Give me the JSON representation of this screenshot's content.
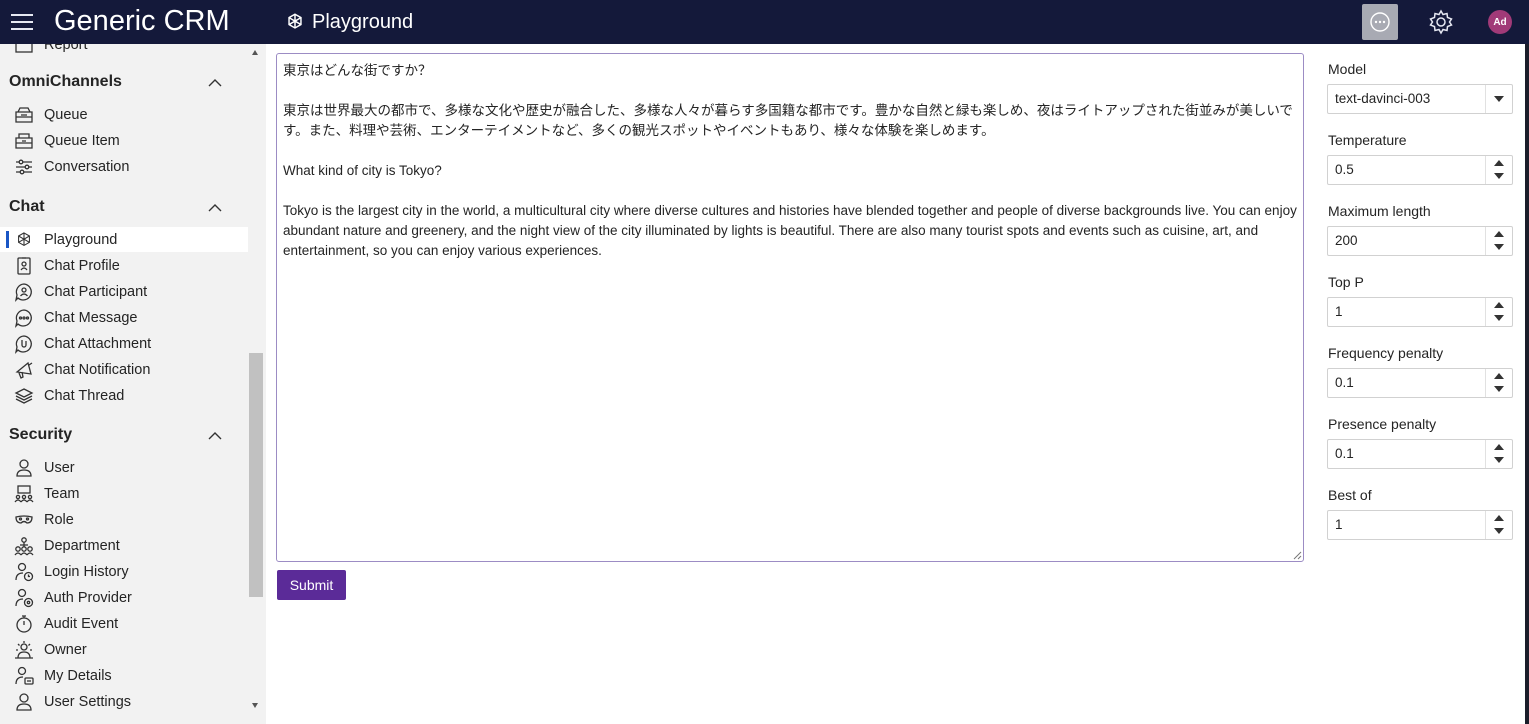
{
  "app": {
    "title": "Generic CRM",
    "page_title": "Playground",
    "avatar_initials": "Ad"
  },
  "sidebar": {
    "partial_item": "Report",
    "sections": [
      {
        "label": "OmniChannels",
        "items": [
          {
            "label": "Queue",
            "icon": "queue-icon"
          },
          {
            "label": "Queue Item",
            "icon": "queue-item-icon"
          },
          {
            "label": "Conversation",
            "icon": "sliders-icon"
          }
        ]
      },
      {
        "label": "Chat",
        "items": [
          {
            "label": "Playground",
            "icon": "openai-icon",
            "active": true
          },
          {
            "label": "Chat Profile",
            "icon": "id-badge-icon"
          },
          {
            "label": "Chat Participant",
            "icon": "person-bubble-icon"
          },
          {
            "label": "Chat Message",
            "icon": "chat-dots-icon"
          },
          {
            "label": "Chat Attachment",
            "icon": "chat-attachment-icon"
          },
          {
            "label": "Chat Notification",
            "icon": "megaphone-icon"
          },
          {
            "label": "Chat Thread",
            "icon": "layers-icon"
          }
        ]
      },
      {
        "label": "Security",
        "items": [
          {
            "label": "User",
            "icon": "person-icon"
          },
          {
            "label": "Team",
            "icon": "team-icon"
          },
          {
            "label": "Role",
            "icon": "mask-icon"
          },
          {
            "label": "Department",
            "icon": "org-chart-icon"
          },
          {
            "label": "Login History",
            "icon": "person-clock-icon"
          },
          {
            "label": "Auth Provider",
            "icon": "person-key-icon"
          },
          {
            "label": "Audit Event",
            "icon": "stopwatch-icon"
          },
          {
            "label": "Owner",
            "icon": "owner-icon"
          },
          {
            "label": "My Details",
            "icon": "person-card-icon"
          },
          {
            "label": "User Settings",
            "icon": "person-settings-icon"
          }
        ]
      }
    ]
  },
  "prompt": {
    "paragraphs": [
      "東京はどんな街ですか？",
      "東京は世界最大の都市で、多様な文化や歴史が融合した、多様な人々が暮らす多国籍な都市です。豊かな自然と緑も楽しめ、夜はライトアップされた街並みが美しいです。また、料理や芸術、エンターテイメントなど、多くの観光スポットやイベントもあり、様々な体験を楽しめます。",
      "What kind of city is Tokyo?",
      "Tokyo is the largest city in the world, a multicultural city where diverse cultures and histories have blended together and people of diverse backgrounds live. You can enjoy abundant nature and greenery, and the night view of the city illuminated by lights is beautiful. There are also many tourist spots and events such as cuisine, art, and entertainment, so you can enjoy various experiences."
    ]
  },
  "submit_label": "Submit",
  "params": {
    "model": {
      "label": "Model",
      "value": "text-davinci-003"
    },
    "temperature": {
      "label": "Temperature",
      "value": "0.5"
    },
    "max_length": {
      "label": "Maximum length",
      "value": "200"
    },
    "top_p": {
      "label": "Top P",
      "value": "1"
    },
    "frequency_penalty": {
      "label": "Frequency penalty",
      "value": "0.1"
    },
    "presence_penalty": {
      "label": "Presence penalty",
      "value": "0.1"
    },
    "best_of": {
      "label": "Best of",
      "value": "1"
    }
  },
  "colors": {
    "topbar": "#14193a",
    "accent": "#5b2b98",
    "active_indicator": "#1a56c5",
    "avatar": "#a13a78"
  }
}
